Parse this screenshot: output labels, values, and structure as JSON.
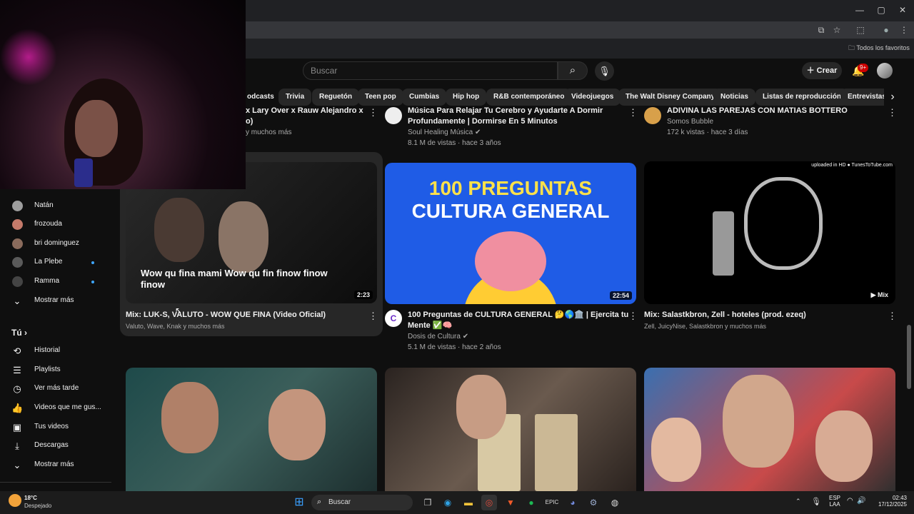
{
  "browser": {
    "bookmarks_label": "Todos los favoritos"
  },
  "header": {
    "search_placeholder": "Buscar",
    "create_label": "Crear",
    "notifications_badge": "9+"
  },
  "chips": [
    "odcasts",
    "Trivia",
    "Reguetón",
    "Teen pop",
    "Cumbias",
    "Hip hop",
    "R&B contemporáneo",
    "Videojuegos",
    "The Walt Disney Company",
    "Noticias",
    "Listas de reproducción",
    "Entrevistas p"
  ],
  "sidebar": {
    "subscriptions": [
      {
        "label": "Natán",
        "dot": false,
        "color": "#9e9e9e"
      },
      {
        "label": "frozouda",
        "dot": false,
        "color": "#c47a6a"
      },
      {
        "label": "bri dominguez",
        "dot": false,
        "color": "#8a6b5c"
      },
      {
        "label": "La Plebe",
        "dot": true,
        "color": "#5a5a5a"
      },
      {
        "label": "Ramma",
        "dot": true,
        "color": "#444"
      }
    ],
    "show_more": "Mostrar más",
    "you_label": "Tú",
    "you_items": [
      {
        "label": "Historial",
        "icon": "history-icon"
      },
      {
        "label": "Playlists",
        "icon": "playlists-icon"
      },
      {
        "label": "Ver más tarde",
        "icon": "clock-icon"
      },
      {
        "label": "Videos que me gus...",
        "icon": "thumb-up-icon"
      },
      {
        "label": "Tus videos",
        "icon": "your-videos-icon"
      },
      {
        "label": "Descargas",
        "icon": "download-icon"
      }
    ],
    "show_more_2": "Mostrar más"
  },
  "top_row": [
    {
      "title_tail": "x Lary Over x Rauw Alejandro x",
      "title_tail2": "o)",
      "meta": "y muchos más"
    },
    {
      "title": "Música Para Relajar Tu Cerebro y Ayudarte A Dormir",
      "title2": "Profundamente | Dormirse En 5 Minutos",
      "channel": "Soul Healing Música",
      "stats": "8.1 M de vistas · hace 3 años"
    },
    {
      "title": "ADIVINA LAS PAREJAS CON MATIAS BOTTERO",
      "channel": "Somos Bubble",
      "stats": "172 k vistas · hace 3 días"
    }
  ],
  "videos": [
    {
      "title": "Mix: LUK-S, VALUTO - WOW QUE FINA (Video Oficial)",
      "meta": "Valuto, Wave, Knak y muchos más",
      "duration": "2:23",
      "caption": "Wow qu fina mami Wow qu fin finow finow finow"
    },
    {
      "title": "100 Preguntas de CULTURA GENERAL 🤔🌎🏛️ | Ejercita tu",
      "title2": "Mente ✅🧠",
      "channel": "Dosis de Cultura",
      "stats": "5.1 M de vistas · hace 2 años",
      "duration": "22:54",
      "thumb_line1": "100 PREGUNTAS",
      "thumb_line2": "CULTURA GENERAL"
    },
    {
      "title": "Mix: Salastkbron, Zell - hoteles (prod. ezeq)",
      "meta": "Zell, JuicyNise, Salastkbron y muchos más",
      "duration": "Mix",
      "watermark": "uploaded in HD ● TunesToTube.com"
    }
  ],
  "taskbar": {
    "temp": "18°C",
    "weather": "Despejado",
    "search": "Buscar",
    "lang1": "ESP",
    "lang2": "LAA",
    "time": "02:43",
    "date": "17/12/2025"
  }
}
